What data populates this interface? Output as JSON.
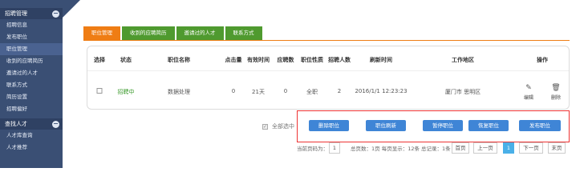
{
  "sidebar": {
    "section1": "招聘管理",
    "items": [
      "招聘信息",
      "发布职位",
      "职位管理",
      "收到的应聘简历",
      "邀请过的人才",
      "联系方式",
      "简历设置",
      "招聘偏好"
    ],
    "section2": "查找人才",
    "items2": [
      "人才库查询",
      "人才推荐"
    ],
    "toggle": "−"
  },
  "tabs": [
    "职位管理",
    "收到的应聘简历",
    "邀请过的人才",
    "联系方式"
  ],
  "table": {
    "headers": {
      "select": "选择",
      "status": "状态",
      "name": "职位名称",
      "clicks": "点击量",
      "valid": "有效时间",
      "applicants": "应聘数",
      "nature": "职位性质",
      "count": "招聘人数",
      "refresh": "刷新时间",
      "area": "工作地区",
      "ops": "操作"
    },
    "row": {
      "status": "招聘中",
      "name": "数据处理",
      "clicks": "0",
      "valid": "21天",
      "applicants": "0",
      "nature": "全职",
      "count": "2",
      "refresh": "2016/1/1 12:23:23",
      "area": "厦门市 思明区",
      "edit": "编辑",
      "delete": "删除"
    }
  },
  "actions": {
    "select_all": "全部选中",
    "buttons": [
      "删除职位",
      "职位刷新",
      "暂停职位",
      "恢复职位",
      "发布职位"
    ]
  },
  "pager": {
    "current_label": "当前页码为：",
    "current_value": "1",
    "summary": "总页数：1页 每页显示：12条 总记录：1条",
    "first": "首页",
    "prev": "上一页",
    "page": "1",
    "next": "下一页",
    "last": "末页"
  },
  "colors": {
    "accent_orange": "#ef7d14",
    "tab_green": "#4f9a2f",
    "button_blue": "#3f85d6",
    "sidebar": "#3a4f74"
  }
}
